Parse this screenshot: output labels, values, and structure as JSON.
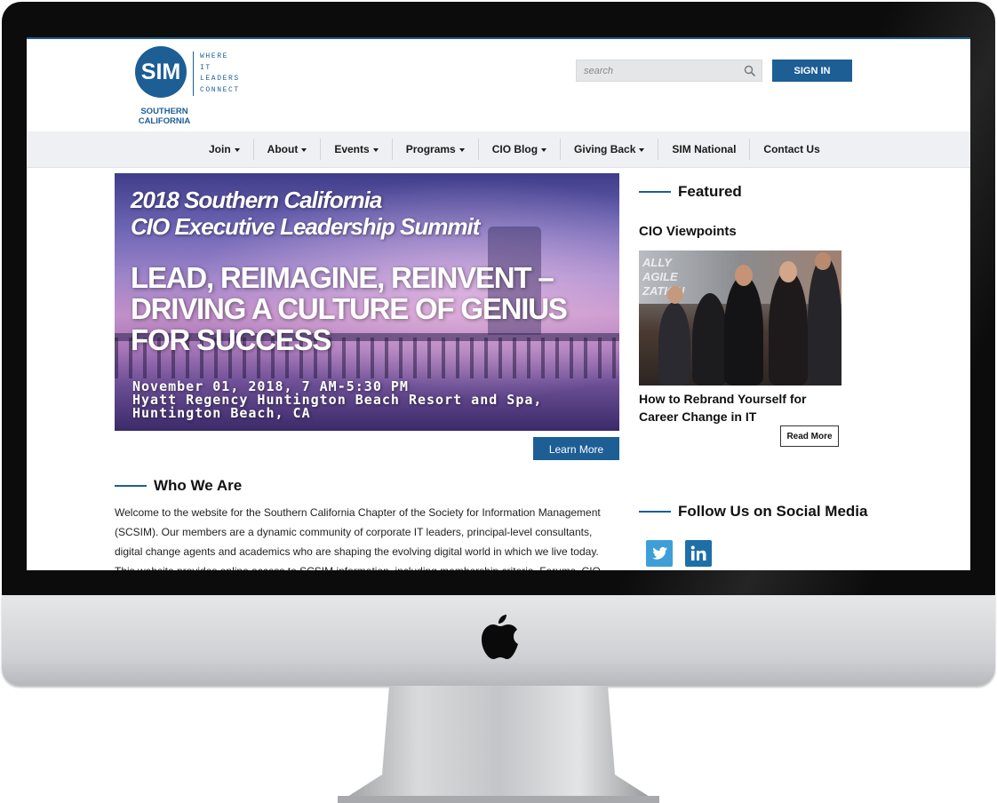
{
  "logo": {
    "mark": "SIM",
    "tagline": [
      "WHERE",
      "IT",
      "LEADERS",
      "CONNECT"
    ],
    "chapter": [
      "SOUTHERN",
      "CALIFORNIA"
    ]
  },
  "header": {
    "search_placeholder": "search",
    "signin_label": "SIGN IN"
  },
  "nav": {
    "items": [
      {
        "label": "Join",
        "dropdown": true
      },
      {
        "label": "About",
        "dropdown": true
      },
      {
        "label": "Events",
        "dropdown": true
      },
      {
        "label": "Programs",
        "dropdown": true
      },
      {
        "label": "CIO Blog",
        "dropdown": true
      },
      {
        "label": "Giving Back",
        "dropdown": true
      },
      {
        "label": "SIM National",
        "dropdown": false
      },
      {
        "label": "Contact Us",
        "dropdown": false
      }
    ]
  },
  "hero": {
    "title_line1": "2018 Southern California",
    "title_line2": "CIO Executive Leadership Summit",
    "headline": [
      "LEAD, REIMAGINE, REINVENT –",
      "DRIVING A CULTURE OF GENIUS",
      "FOR SUCCESS"
    ],
    "details": [
      "November 01, 2018, 7 AM-5:30 PM",
      "Hyatt Regency Huntington Beach Resort and Spa,",
      "Huntington Beach, CA"
    ],
    "button_label": "Learn More"
  },
  "who_we_are": {
    "heading": "Who We Are",
    "text": "Welcome to the website for the Southern California Chapter of the Society for Information Management (SCSIM). Our members are a dynamic community of corporate IT leaders, principal-level consultants, digital change agents and academics who are shaping the evolving digital world in which we live today. This website provides online access to SCSIM information, including membership criteria, Forums, CIO Enclaves"
  },
  "featured": {
    "heading": "Featured",
    "subheading": "CIO Viewpoints",
    "image_text": "ALLY AGILE ZATION",
    "caption": "How to Rebrand Yourself for Career Change in IT",
    "button_label": "Read More"
  },
  "social": {
    "heading": "Follow Us on Social Media",
    "icons": [
      "twitter-icon",
      "linkedin-icon"
    ]
  },
  "colors": {
    "brand": "#1d5e95",
    "nav_bg": "#eef0f3",
    "twitter": "#3e9fd8",
    "linkedin": "#1e6fa8"
  }
}
